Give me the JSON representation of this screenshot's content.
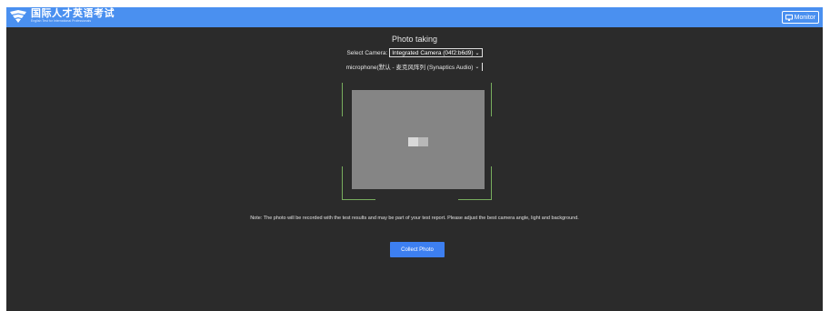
{
  "header": {
    "logo_cn": "国际人才英语考试",
    "logo_en": "English Test for International Professionals",
    "monitor_label": "Monitor",
    "brand_color": "#4a90f0"
  },
  "main": {
    "title": "Photo taking",
    "camera_label": "Select Camera:",
    "camera_value": "Integrated Camera (04f2:b6d9)",
    "mic_value": "microphone(默认 - 麦克风阵列 (Synaptics Audio)",
    "note": "Note: The photo will be recorded with the test results and may be part of your test report. Please adjust the best camera angle, light and background.",
    "collect_label": "Collect Photo",
    "frame_color": "#78ad5e",
    "button_color": "#3d7ff0"
  },
  "icons": {
    "logo": "logo-emblem-icon",
    "monitor": "monitor-icon",
    "dropdown": "chevron-down-icon",
    "preview_placeholder": "image-placeholder-icon"
  }
}
